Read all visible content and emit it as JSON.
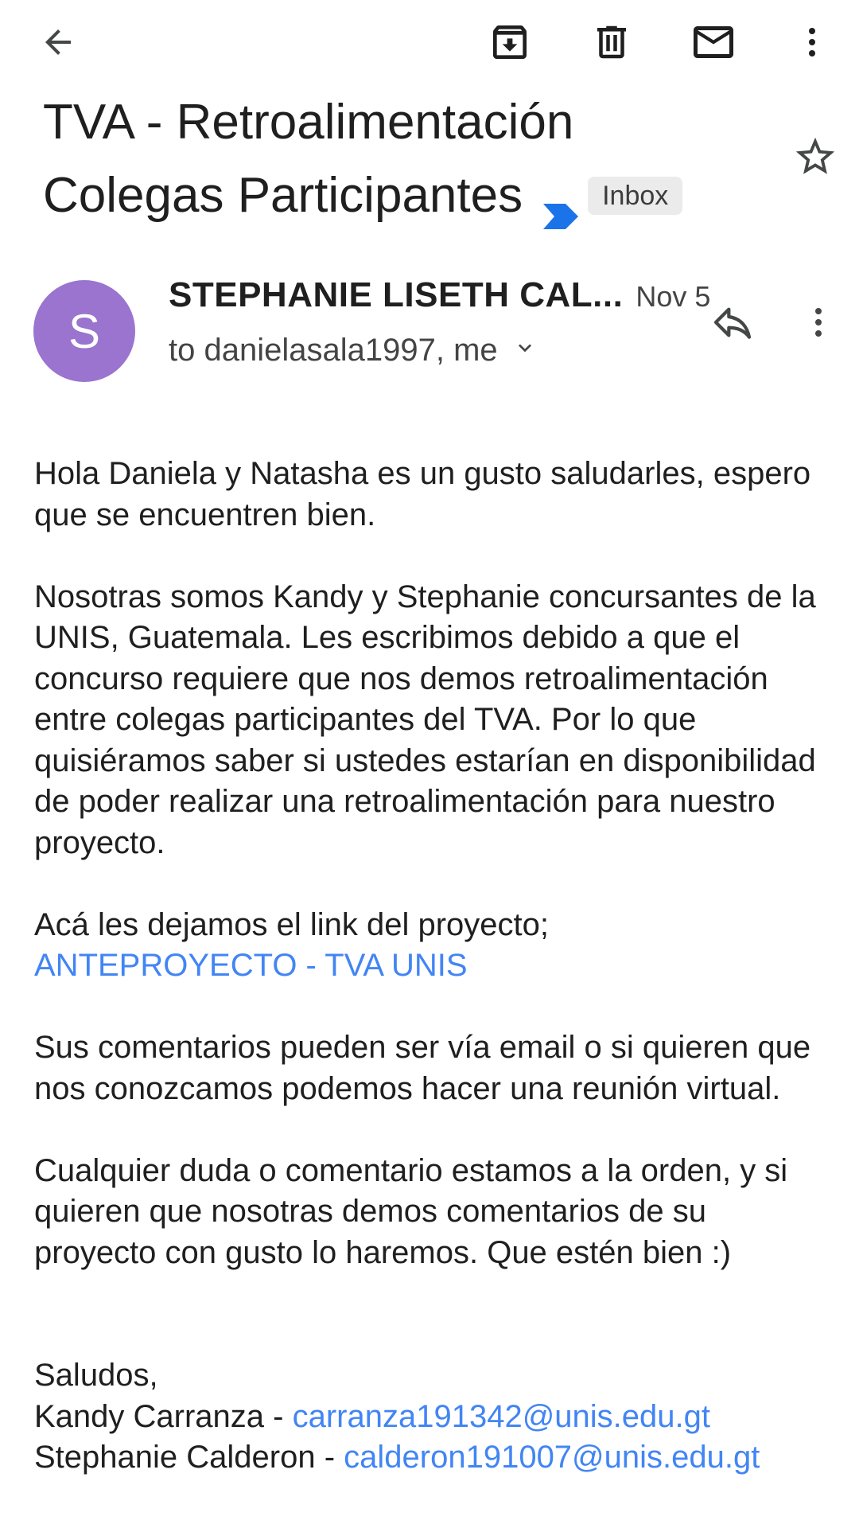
{
  "toolbar": {
    "back_icon": "arrow-back-icon",
    "archive_icon": "archive-icon",
    "delete_icon": "delete-icon",
    "mark_unread_icon": "mail-icon",
    "more_icon": "more-vert-icon"
  },
  "subject": {
    "line1": "TVA - Retroalimentación",
    "line2": "Colegas Participantes",
    "label_chip": "Inbox",
    "label_arrow_color": "#1a73e8"
  },
  "message": {
    "avatar_letter": "S",
    "avatar_color": "#9a74cf",
    "sender": "STEPHANIE LISETH CAL...",
    "date": "Nov 5",
    "recipients": "to danielasala1997, me"
  },
  "body": {
    "p1": "Hola Daniela y Natasha es un gusto saludarles, espero que se encuentren bien.",
    "p2": "Nosotras somos Kandy y Stephanie concursantes de la UNIS, Guatemala. Les escribimos debido a que el concurso requiere que nos demos retroalimentación entre colegas participantes del TVA. Por lo que quisiéramos saber si ustedes estarían en disponibilidad de poder realizar una retroalimentación para nuestro proyecto.",
    "p3_text": "Acá les dejamos el link del proyecto;",
    "p3_link": "ANTEPROYECTO - TVA UNIS",
    "p4": "Sus comentarios pueden ser vía email o si quieren que nos conozcamos podemos hacer una reunión virtual.",
    "p5": "Cualquier duda o comentario estamos a la orden, y si quieren que nosotras demos comentarios de su proyecto con gusto lo haremos. Que estén bien :)",
    "sig_greeting": "Saludos,",
    "sig1_name": "Kandy Carranza - ",
    "sig1_email": "carranza191342@unis.edu.gt",
    "sig2_name": "Stephanie Calderon - ",
    "sig2_email": "calderon191007@unis.edu.gt"
  },
  "colors": {
    "link": "#4285f4",
    "text": "#1f1f1f",
    "secondary_text": "#444444"
  }
}
